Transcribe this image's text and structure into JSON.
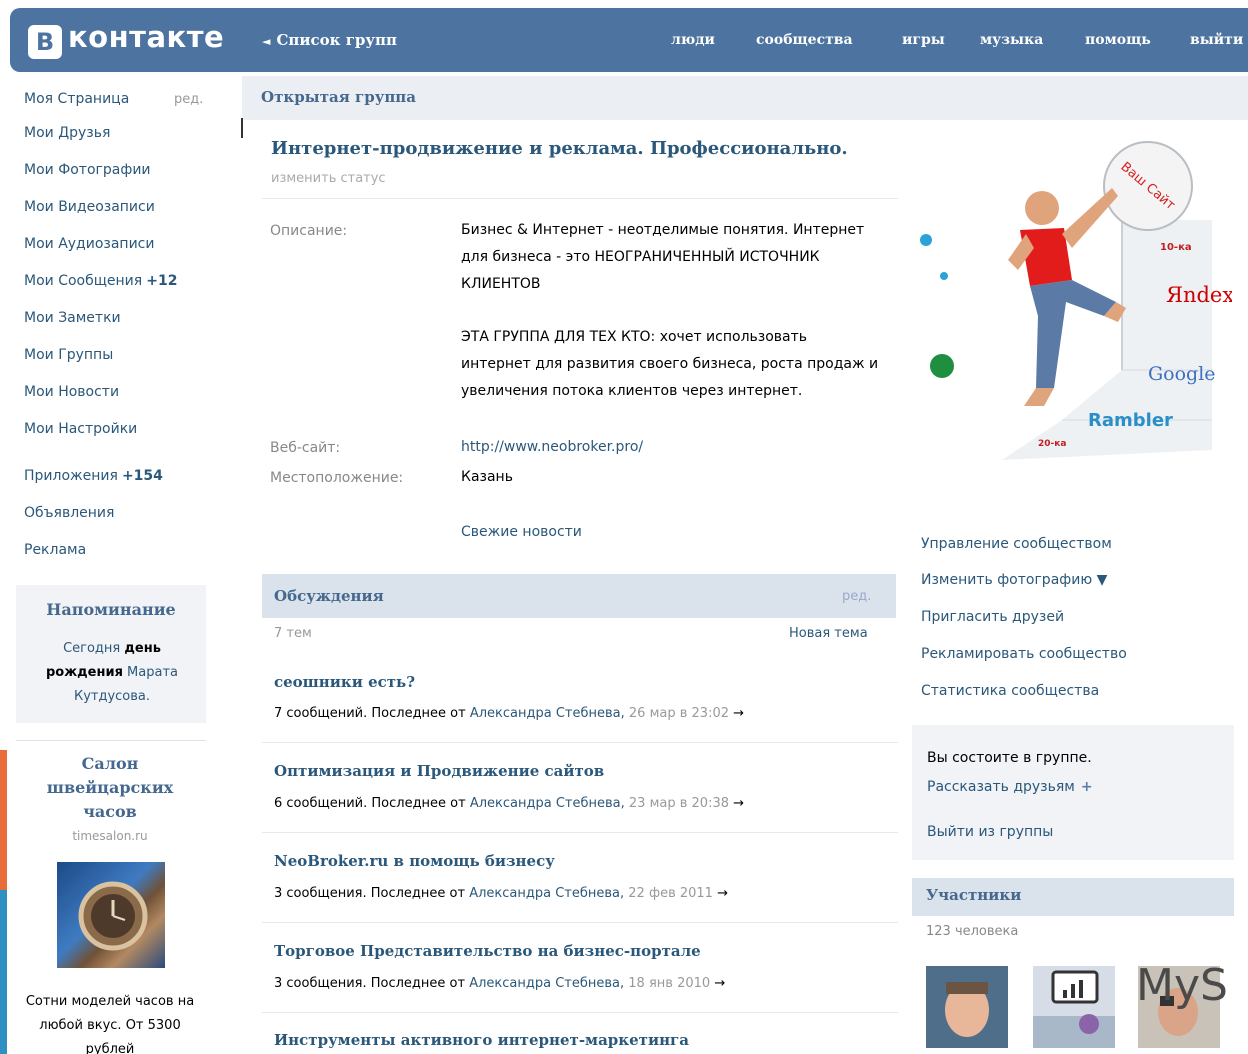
{
  "header": {
    "logo_letter": "В",
    "logo_text": "контакте",
    "back_arrow": "◄",
    "back_label": "Список групп",
    "nav": [
      "люди",
      "сообщества",
      "игры",
      "музыка",
      "помощь",
      "выйти"
    ]
  },
  "sidebar": {
    "edit_label": "ред.",
    "items": [
      {
        "label": "Моя Страница",
        "count": ""
      },
      {
        "label": "Мои Друзья",
        "count": ""
      },
      {
        "label": "Мои Фотографии",
        "count": ""
      },
      {
        "label": "Мои Видеозаписи",
        "count": ""
      },
      {
        "label": "Мои Аудиозаписи",
        "count": ""
      },
      {
        "label": "Мои Сообщения",
        "count": "+12"
      },
      {
        "label": "Мои Заметки",
        "count": ""
      },
      {
        "label": "Мои Группы",
        "count": ""
      },
      {
        "label": "Мои Новости",
        "count": ""
      },
      {
        "label": "Мои Настройки",
        "count": ""
      },
      {
        "label": "Приложения",
        "count": "+154"
      },
      {
        "label": "Объявления",
        "count": ""
      },
      {
        "label": "Реклама",
        "count": ""
      }
    ],
    "reminder": {
      "title": "Напоминание",
      "text_1": "Сегодня ",
      "text_bold": "день рождения",
      "text_2": " Марата Кутдусова."
    },
    "ad": {
      "title": "Салон швейцарских часов",
      "domain": "timesalon.ru",
      "text": "Сотни моделей часов на любой вкус. От 5300 рублей"
    }
  },
  "main": {
    "group_type": "Открытая группа",
    "group_name": "Интернет-продвижение и реклама. Профессионально.",
    "change_status": "изменить статус",
    "info": {
      "description_label": "Описание:",
      "description_1": "Бизнес & Интернет - неотделимые понятия. Интернет для бизнеса - это НЕОГРАНИЧЕННЫЙ ИСТОЧНИК КЛИЕНТОВ",
      "description_2": "ЭТА ГРУППА ДЛЯ ТЕХ КТО: хочет использовать интернет для развития своего бизнеса, роста продаж и увеличения потока клиентов через интернет.",
      "website_label": "Веб-сайт:",
      "website": "http://www.neobroker.pro/",
      "location_label": "Местоположение:",
      "location": "Казань",
      "fresh_news": "Свежие новости"
    },
    "discussions": {
      "title": "Обсуждения",
      "edit": "ред.",
      "count": "7 тем",
      "new_topic": "Новая тема",
      "topics": [
        {
          "title": "сеошники есть?",
          "meta": "7 сообщений. Последнее от ",
          "author": "Александра Стебнева,",
          "date": " 26 мар в 23:02",
          "arrow": "→"
        },
        {
          "title": "Оптимизация и Продвижение сайтов",
          "meta": "6 сообщений. Последнее от ",
          "author": "Александра Стебнева,",
          "date": " 23 мар в 20:38",
          "arrow": "→"
        },
        {
          "title": "NeoBroker.ru в помощь бизнесу",
          "meta": "3 сообщения. Последнее от ",
          "author": "Александра Стебнева,",
          "date": " 22 фев 2011",
          "arrow": "→"
        },
        {
          "title": "Торговое Представительство на бизнес-портале",
          "meta": "3 сообщения. Последнее от ",
          "author": "Александра Стебнева,",
          "date": " 18 янв 2010",
          "arrow": "→"
        },
        {
          "title": "Инструменты активного интернет-маркетинга",
          "meta": "",
          "author": "",
          "date": "",
          "arrow": ""
        }
      ]
    }
  },
  "right": {
    "photo_labels": {
      "ball": "Ваш Сайт",
      "tag_top": "10-ка",
      "yandex": "Яndex",
      "google": "Google",
      "rambler": "Rambler",
      "tag_bottom": "20-ка"
    },
    "actions": [
      "Управление сообществом",
      "Изменить фотографию ▼",
      "Пригласить друзей",
      "Рекламировать сообщество",
      "Статистика сообщества"
    ],
    "member_status": "Вы состоите в группе.",
    "tell_friends": "Рассказать друзьям",
    "tell_plus": "+",
    "leave": "Выйти из группы",
    "participants_title": "Участники",
    "participants_count": "123 человека",
    "overlay_text": "MyS"
  },
  "colors": {
    "header_bg": "#4d74a0",
    "link": "#2b587a",
    "section_bar": "#dae2ec"
  }
}
